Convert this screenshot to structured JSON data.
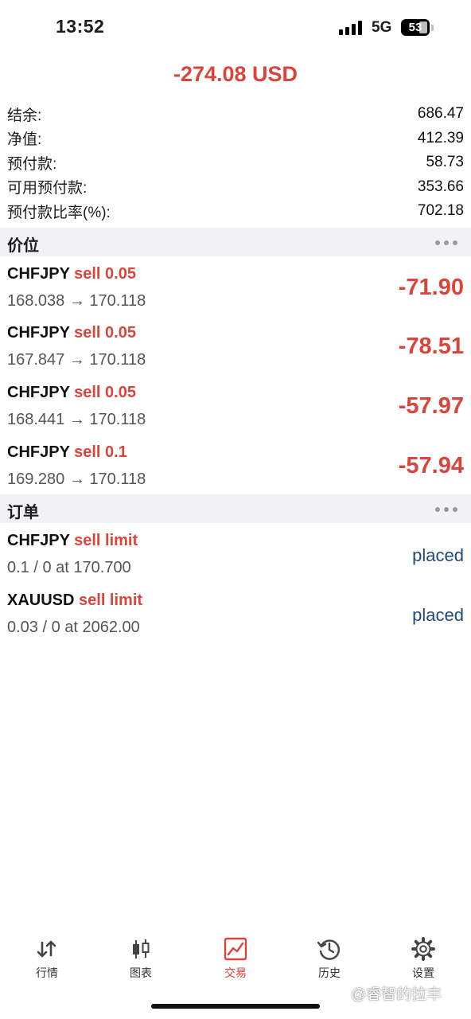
{
  "status": {
    "time": "13:52",
    "network": "5G",
    "battery": "53"
  },
  "header": {
    "total_pl": "-274.08 USD"
  },
  "account": [
    {
      "label": "结余:",
      "value": "686.47"
    },
    {
      "label": "净值:",
      "value": "412.39"
    },
    {
      "label": "预付款:",
      "value": "58.73"
    },
    {
      "label": "可用预付款:",
      "value": "353.66"
    },
    {
      "label": "预付款比率(%):",
      "value": "702.18"
    }
  ],
  "positions_section": {
    "title": "价位"
  },
  "positions": [
    {
      "symbol": "CHFJPY",
      "side": "sell 0.05",
      "prices": "168.038 → 170.118",
      "pnl": "-71.90"
    },
    {
      "symbol": "CHFJPY",
      "side": "sell 0.05",
      "prices": "167.847 → 170.118",
      "pnl": "-78.51"
    },
    {
      "symbol": "CHFJPY",
      "side": "sell 0.05",
      "prices": "168.441 → 170.118",
      "pnl": "-57.97"
    },
    {
      "symbol": "CHFJPY",
      "side": "sell 0.1",
      "prices": "169.280 → 170.118",
      "pnl": "-57.94"
    }
  ],
  "orders_section": {
    "title": "订单"
  },
  "orders": [
    {
      "symbol": "CHFJPY",
      "side": "sell limit",
      "detail": "0.1 / 0 at 170.700",
      "state": "placed"
    },
    {
      "symbol": "XAUUSD",
      "side": "sell limit",
      "detail": "0.03 / 0 at 2062.00",
      "state": "placed"
    }
  ],
  "tabs": [
    {
      "label": "行情",
      "icon": "quotes-arrows-icon"
    },
    {
      "label": "图表",
      "icon": "candlestick-chart-icon"
    },
    {
      "label": "交易",
      "icon": "trade-chart-icon",
      "active": true
    },
    {
      "label": "历史",
      "icon": "history-clock-icon"
    },
    {
      "label": "设置",
      "icon": "gear-icon"
    }
  ],
  "watermark": "@睿智的拉丰",
  "colors": {
    "loss": "#d9453a",
    "placed": "#1e4a7a",
    "active_tab": "#d9453a"
  }
}
